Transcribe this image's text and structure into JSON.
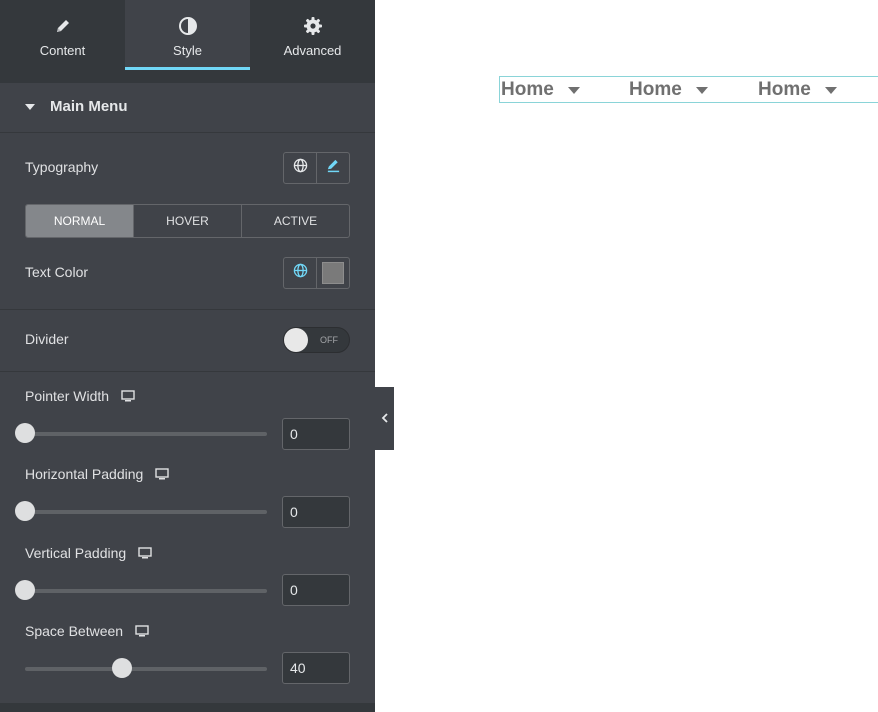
{
  "tabs": [
    {
      "label": "Content",
      "icon": "pencil-icon"
    },
    {
      "label": "Style",
      "icon": "half-circle-icon"
    },
    {
      "label": "Advanced",
      "icon": "gear-icon"
    }
  ],
  "active_tab": "Style",
  "section": {
    "title": "Main Menu"
  },
  "typography": {
    "label": "Typography",
    "icons": [
      "globe-icon",
      "pencil-icon"
    ]
  },
  "state_tabs": [
    {
      "label": "NORMAL",
      "active": true
    },
    {
      "label": "HOVER",
      "active": false
    },
    {
      "label": "ACTIVE",
      "active": false
    }
  ],
  "text_color": {
    "label": "Text Color",
    "swatch": "#7a7a7a"
  },
  "divider": {
    "label": "Divider",
    "toggle_text": "OFF",
    "on": false
  },
  "controls": [
    {
      "label": "Pointer Width",
      "value": "0",
      "fraction": 0
    },
    {
      "label": "Horizontal Padding",
      "value": "0",
      "fraction": 0
    },
    {
      "label": "Vertical Padding",
      "value": "0",
      "fraction": 0
    },
    {
      "label": "Space Between",
      "value": "40",
      "fraction": 0.4
    }
  ],
  "preview": {
    "menu_items": [
      "Home",
      "Home",
      "Home"
    ]
  },
  "colors": {
    "panel_bg": "#404349",
    "accent": "#71d7f7",
    "menu_text": "#707070",
    "selection_border": "#8ad4d8"
  }
}
